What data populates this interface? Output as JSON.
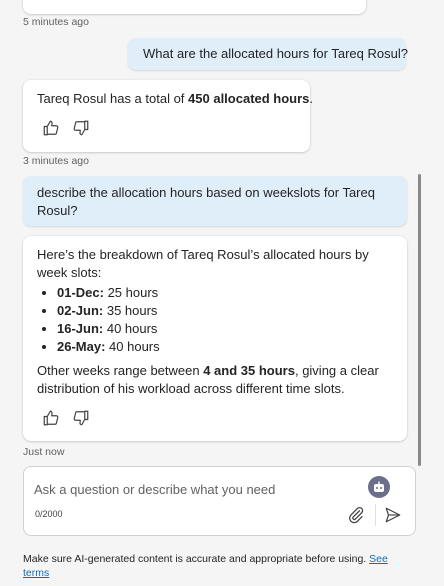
{
  "messages": {
    "top_timestamp": "5 minutes ago",
    "user_q1": "What are the allocated hours for Tareq Rosul?",
    "bot_a1": {
      "prefix": "Tareq Rosul has a total of ",
      "bold": "450 allocated hours",
      "suffix": "."
    },
    "a1_timestamp": "3 minutes ago",
    "user_q2": "describe the allocation hours based on weekslots for Tareq Rosul?",
    "bot_a2": {
      "intro": "Here’s the breakdown of Tareq Rosul’s allocated hours by week slots:",
      "items": [
        {
          "week": "01-Dec:",
          "hours": " 25 hours"
        },
        {
          "week": "02-Jun:",
          "hours": " 35 hours"
        },
        {
          "week": "16-Jun:",
          "hours": " 40 hours"
        },
        {
          "week": "26-May:",
          "hours": " 40 hours"
        }
      ],
      "outro_prefix": "Other weeks range between ",
      "outro_bold": "4 and 35 hours",
      "outro_suffix": ", giving a clear distribution of his workload across different time slots."
    },
    "a2_timestamp": "Just now"
  },
  "feedback_icons": [
    "thumbs-up-icon",
    "thumbs-down-icon"
  ],
  "composer": {
    "placeholder": "Ask a question or describe what you need",
    "counter": "0/2000"
  },
  "disclaimer": {
    "text": "Make sure AI-generated content is accurate and appropriate before using. ",
    "link": "See terms"
  },
  "colors": {
    "user_bubble": "#e0eefa",
    "background": "#f5f5f5",
    "link": "#0f6cbd"
  }
}
